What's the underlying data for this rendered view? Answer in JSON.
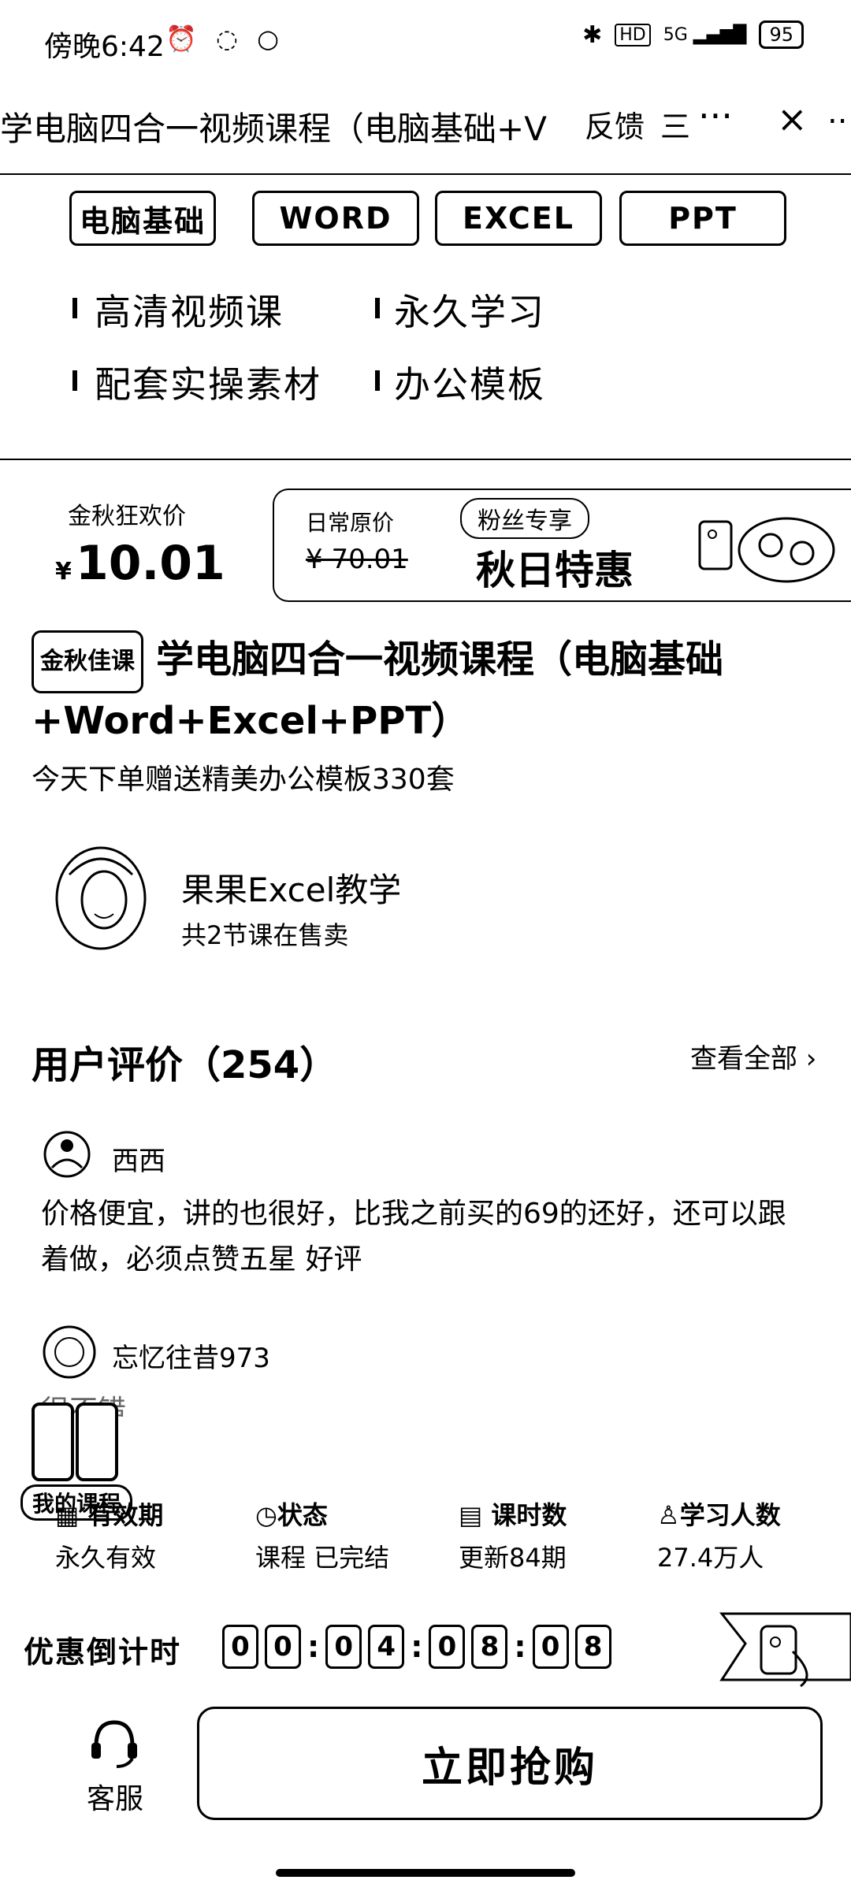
{
  "status_bar": {
    "time": "傍晚6:42",
    "battery": "95",
    "signal_label": "5G"
  },
  "header": {
    "title": "学电脑四合一视频课程（电脑基础+V",
    "feedback": "反馈",
    "menu_glyph": "三",
    "more_glyph": "···",
    "close_glyph": "×",
    "overflow_glyph": ".."
  },
  "tabs": [
    "电脑基础",
    "WORD",
    "EXCEL",
    "PPT"
  ],
  "features": [
    "高清视频课",
    "永久学习",
    "配套实操素材",
    "办公模板"
  ],
  "banner": {
    "price_label": "金秋狂欢价",
    "currency": "¥",
    "price": "10.01",
    "original_label": "日常原价",
    "original_price": "¥ 70.01",
    "fans_label": "粉丝专享",
    "promo_text": "秋日特惠"
  },
  "course": {
    "tag": "金秋佳课",
    "title": "学电脑四合一视频课程（电脑基础+Word+Excel+PPT）",
    "gift": "今天下单赠送精美办公模板330套"
  },
  "author": {
    "name": "果果Excel教学",
    "subtitle": "共2节课在售卖"
  },
  "reviews": {
    "heading": "用户评价（254）",
    "see_all": "查看全部",
    "items": [
      {
        "user": "西西",
        "text": "价格便宜，讲的也很好，比我之前买的69的还好，还可以跟着做，必须点赞五星 好评"
      },
      {
        "user": "忘忆往昔973",
        "text": "很不错"
      }
    ]
  },
  "floating": {
    "my_courses": "我的课程"
  },
  "info": [
    {
      "label": "有效期",
      "value": "永久有效",
      "icon": "calendar-icon"
    },
    {
      "label": "状态",
      "value": "课程 已完结",
      "icon": "clock-icon"
    },
    {
      "label": "课时数",
      "value": "更新84期",
      "icon": "document-icon"
    },
    {
      "label": "学习人数",
      "value": "27.4万人",
      "icon": "user-icon"
    }
  ],
  "countdown": {
    "label": "优惠倒计时",
    "digits": [
      "0",
      "0",
      "0",
      "4",
      "0",
      "8",
      "0",
      "8"
    ]
  },
  "bottom": {
    "service": "客服",
    "buy": "立即抢购"
  }
}
